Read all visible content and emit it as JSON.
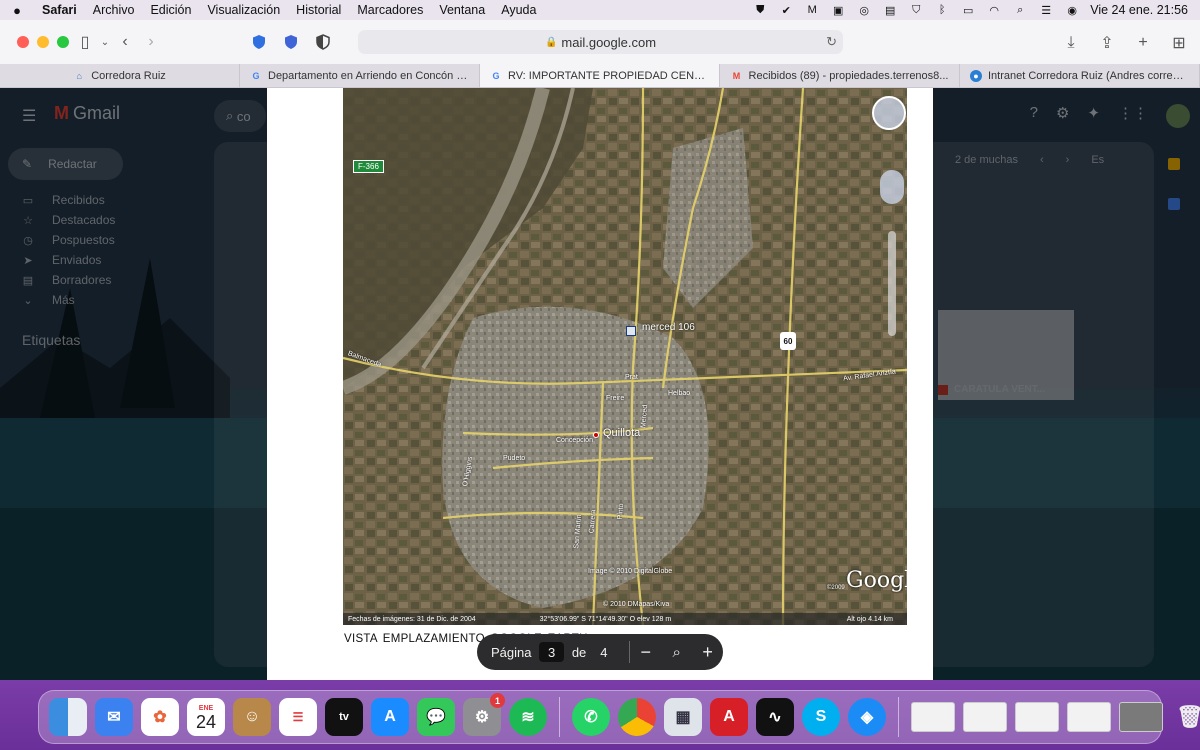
{
  "menubar": {
    "app": "Safari",
    "items": [
      "Archivo",
      "Edición",
      "Visualización",
      "Historial",
      "Marcadores",
      "Ventana",
      "Ayuda"
    ],
    "clock": "Vie 24 ene.  21:56"
  },
  "browser": {
    "address": "mail.google.com",
    "tabs": [
      {
        "title": "Corredora Ruiz"
      },
      {
        "title": "Departamento en Arriendo en Concón | P..."
      },
      {
        "title": "RV: IMPORTANTE PROPIEDAD CENTRAL..."
      },
      {
        "title": "Recibidos (89) - propiedades.terrenos8..."
      },
      {
        "title": "Intranet Corredora Ruiz (Andres corredor)"
      }
    ]
  },
  "gmail": {
    "logo": "Gmail",
    "search_placeholder": "co",
    "compose": "Redactar",
    "nav": [
      "Recibidos",
      "Destacados",
      "Pospuestos",
      "Enviados",
      "Borradores",
      "Más"
    ],
    "labels_heading": "Etiquetas",
    "pager": "2 de muchas",
    "lang": "Es",
    "attachment_title": "CARATULA VENT..."
  },
  "map": {
    "placemark_label": "merced 106",
    "city_label": "Quillota",
    "route_badge": "F-366",
    "highway_badge": "60",
    "streets": [
      "Balmaceda",
      "Prat",
      "Freire",
      "Concepción",
      "Pudeto",
      "O'Higgins",
      "Merced",
      "Pinto",
      "San Martín",
      "Carrera",
      "Av. Rafael Ariztía",
      "Helbao"
    ],
    "copyright_lines": [
      "Image © 2010 DigitalGlobe",
      "© 2010 DMapas/Kiva"
    ],
    "google_logo": "Google",
    "logo_year": "©2009",
    "status": {
      "imagery_date": "Fechas de imágenes: 31 de Dic. de 2004",
      "coords": "32°53'06.99\" S   71°14'49.30\" O   elev  128 m",
      "alt": "Alt  ojo    4.14 km"
    }
  },
  "pdf": {
    "caption": "VISTA  EMPLAZAMIENTO  GOOGLE EARTH",
    "page_label": "Página",
    "page_current": "3",
    "page_of": "de",
    "page_total": "4"
  },
  "dock": {
    "calendar_month": "ENE",
    "calendar_day": "24",
    "settings_badge": "1"
  }
}
